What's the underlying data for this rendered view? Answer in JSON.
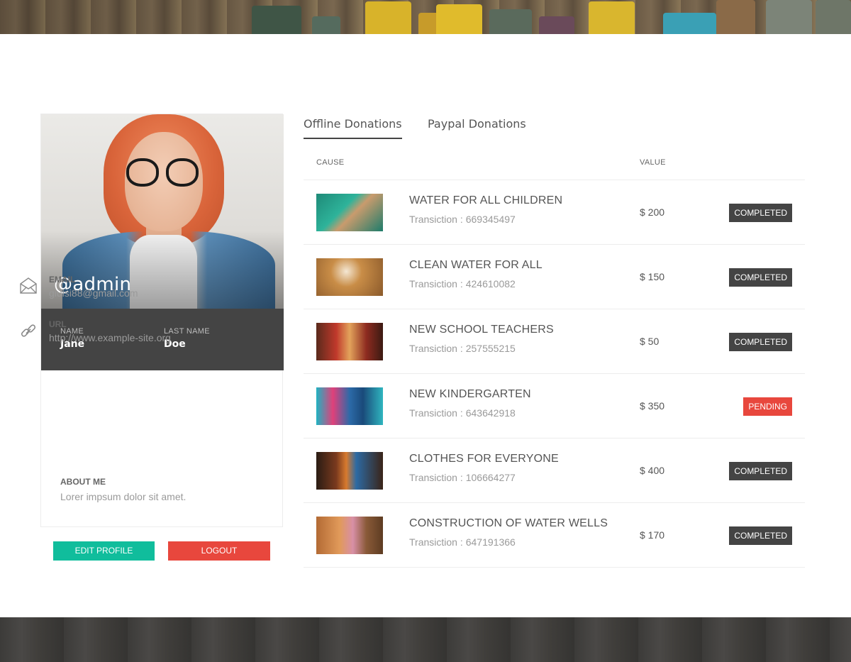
{
  "profile": {
    "handle": "@admin",
    "name_label": "NAME",
    "name_value": "Jane",
    "last_name_label": "LAST NAME",
    "last_name_value": "Doe",
    "email_label": "EMAIL",
    "email_value": "giulsi88@gmail.com",
    "url_label": "URL",
    "url_value": "http://www.example-site.org",
    "about_label": "ABOUT ME",
    "about_value": "Lorer impsum dolor sit amet."
  },
  "buttons": {
    "edit": "EDIT PROFILE",
    "logout": "LOGOUT"
  },
  "tabs": [
    {
      "label": "Offline Donations",
      "active": true
    },
    {
      "label": "Paypal Donations",
      "active": false
    }
  ],
  "table": {
    "headers": {
      "cause": "CAUSE",
      "value": "VALUE"
    },
    "transaction_label": "Transiction :",
    "rows": [
      {
        "title": "WATER FOR ALL CHILDREN",
        "transaction": "669345497",
        "value": "$ 200",
        "status": "COMPLETED"
      },
      {
        "title": "CLEAN WATER FOR ALL",
        "transaction": "424610082",
        "value": "$ 150",
        "status": "COMPLETED"
      },
      {
        "title": "NEW SCHOOL TEACHERS",
        "transaction": "257555215",
        "value": "$ 50",
        "status": "COMPLETED"
      },
      {
        "title": "NEW KINDERGARTEN",
        "transaction": "643642918",
        "value": "$ 350",
        "status": "PENDING"
      },
      {
        "title": "CLOTHES FOR EVERYONE",
        "transaction": "106664277",
        "value": "$ 400",
        "status": "COMPLETED"
      },
      {
        "title": "CONSTRUCTION OF WATER WELLS",
        "transaction": "647191366",
        "value": "$ 170",
        "status": "COMPLETED"
      }
    ]
  },
  "colors": {
    "accent_green": "#10bd9c",
    "accent_red": "#e8473d",
    "dark": "#444444"
  }
}
